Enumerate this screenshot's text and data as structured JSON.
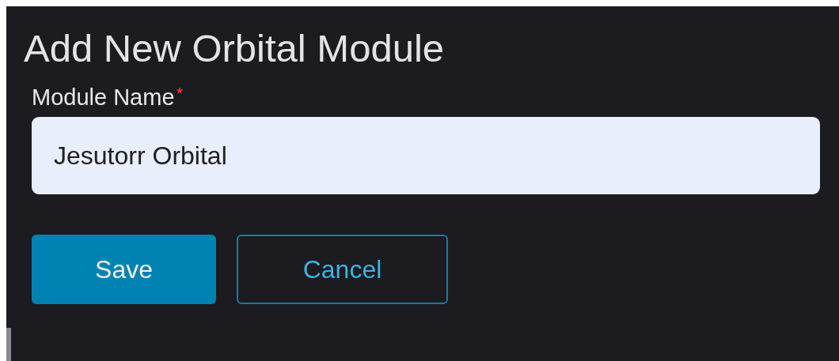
{
  "dialog": {
    "title": "Add New Orbital Module"
  },
  "field": {
    "label": "Module Name",
    "required": true,
    "value": "Jesutorr Orbital"
  },
  "buttons": [
    {
      "label": "Save",
      "kind": "primary"
    },
    {
      "label": "Cancel",
      "kind": "secondary"
    }
  ]
}
